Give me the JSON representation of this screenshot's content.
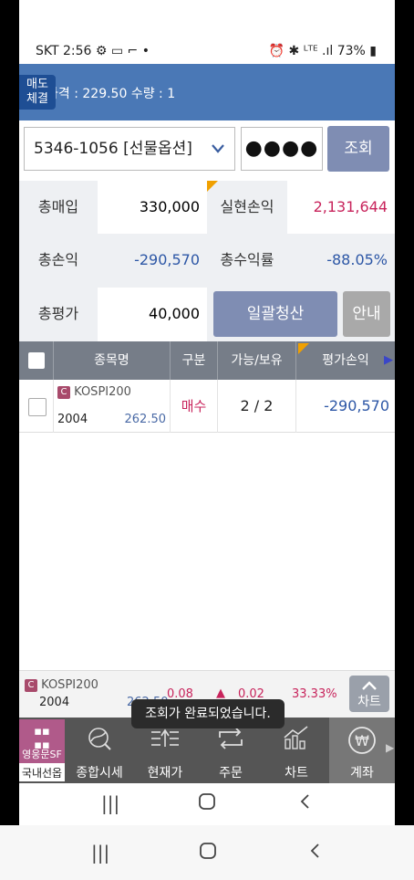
{
  "status_bar": {
    "left": "SKT 2:56 ⚙ ▭ ⌐ •",
    "right": "⏰ ✱ ᴸᵀᴱ .ıl 73% ▮"
  },
  "header": {
    "badge_line1": "매도",
    "badge_line2": "체결",
    "text": "가격 : 229.50 수량 : 1"
  },
  "account": {
    "value": "5346-1056 [선물옵션]",
    "password": "●●●●",
    "query_button": "조회"
  },
  "summary": {
    "total_buy_label": "총매입",
    "total_buy": "330,000",
    "realized_label": "실현손익",
    "realized": "2,131,644",
    "total_pl_label": "총손익",
    "total_pl": "-290,570",
    "total_return_label": "총수익률",
    "total_return": "-88.05%",
    "total_eval_label": "총평가",
    "total_eval": "40,000",
    "liquidate_button": "일괄청산",
    "guide_button": "안내"
  },
  "table": {
    "headers": [
      "종목명",
      "구분",
      "가능/보유",
      "평가손익"
    ],
    "rows": [
      {
        "badge": "C",
        "name": "KOSPI200",
        "month": "2004",
        "price": "262.50",
        "type": "매수",
        "qty": "2 / 2",
        "pl": "-290,570"
      }
    ]
  },
  "ticker": {
    "badge": "C",
    "name": "KOSPI200",
    "month": "2004",
    "price": "262.50",
    "v1": "0.08",
    "arrow": "▲",
    "v2": "0.02",
    "pct": "33.33%",
    "chart_button": "차트"
  },
  "toast": "조회가 완료되었습니다.",
  "nav": {
    "first_label": "국내선옵",
    "first_logo": "영웅문SF",
    "items": [
      {
        "label": "종합시세",
        "icon": "globe-icon"
      },
      {
        "label": "현재가",
        "icon": "price-icon"
      },
      {
        "label": "주문",
        "icon": "swap-icon"
      },
      {
        "label": "차트",
        "icon": "chart-icon"
      },
      {
        "label": "계좌",
        "icon": "won-icon"
      }
    ]
  },
  "colors": {
    "header": "#4a78b6",
    "negative": "#2d57a6",
    "positive": "#c8245c",
    "button": "#7f8db3"
  }
}
